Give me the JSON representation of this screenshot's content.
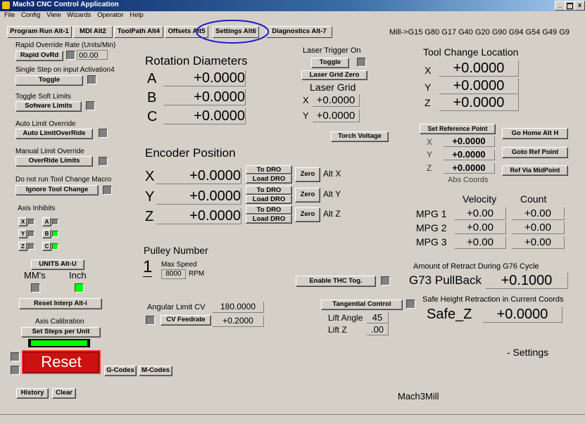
{
  "window": {
    "title": "Mach3 CNC Control Application",
    "min": "_",
    "max": " ",
    "close": "x"
  },
  "menu": [
    "File",
    "Config",
    "View",
    "Wizards",
    "Operator",
    "Help"
  ],
  "tabs": [
    "Program Run Alt-1",
    "MDI Alt2",
    "ToolPath Alt4",
    "Offsets Alt5",
    "Settings Alt6",
    "Diagnostics Alt-7"
  ],
  "gcode_status": "Mill->G15  G80 G17 G40 G20 G90 G94 G54 G49 G9",
  "left": {
    "rapid_override_title": "Rapid Override Rate (Units/Min)",
    "rapid_ovrd_btn": "Rapid OvRd",
    "rapid_value": "00.00",
    "single_step_title": "Single Step on input Activation4",
    "toggle_btn": "Toggle",
    "soft_limits_title": "Toggle Soft Limits",
    "soft_limits_btn": "Sofware Limits",
    "auto_limit_title": "Auto Limit Override",
    "auto_limit_btn": "Auto LimitOverRide",
    "manual_limit_title": "Manual Limit Override",
    "manual_limit_btn": "OverRide Limits",
    "tool_change_title": "Do not run Tool Change Macro",
    "tool_change_btn": "Ignore Tool Change",
    "axis_inhibits_title": "Axis Inhibits",
    "axis_x": "X",
    "axis_a": "A",
    "axis_y": "Y",
    "axis_b": "B",
    "axis_z": "Z",
    "axis_c": "C",
    "units_btn": "UNITS Alt-U",
    "mms_label": "MM's",
    "inch_label": "Inch",
    "reset_interp_btn": "Reset Interp Alt-i",
    "axis_calibration_title": "Axis Calibration",
    "set_steps_btn": "Set Steps per Unit",
    "reset_btn": "Reset",
    "gcodes_btn": "G-Codes",
    "mcodes_btn": "M-Codes",
    "history_btn": "History",
    "clear_btn": "Clear"
  },
  "rotation": {
    "title": "Rotation Diameters",
    "rows": [
      {
        "axis": "A",
        "value": "+0.0000"
      },
      {
        "axis": "B",
        "value": "+0.0000"
      },
      {
        "axis": "C",
        "value": "+0.0000"
      }
    ]
  },
  "encoder": {
    "title": "Encoder Position",
    "rows": [
      {
        "axis": "X",
        "value": "+0.0000",
        "to_dro": "To DRO",
        "load_dro": "Load DRO",
        "zero": "Zero",
        "alt": "Alt X"
      },
      {
        "axis": "Y",
        "value": "+0.0000",
        "to_dro": "To DRO",
        "load_dro": "Load DRO",
        "zero": "Zero",
        "alt": "Alt Y"
      },
      {
        "axis": "Z",
        "value": "+0.0000",
        "to_dro": "To DRO",
        "load_dro": "Load DRO",
        "zero": "Zero",
        "alt": "Alt Z"
      }
    ]
  },
  "pulley": {
    "title": "Pulley Number",
    "number": "1",
    "max_speed_label": "Max Speed",
    "max_speed": "8000",
    "rpm": "RPM"
  },
  "angular": {
    "label": "Angular Limit CV",
    "value": "180.0000",
    "cv_feedrate_btn": "CV Feedrate",
    "cv_value": "+0.2000"
  },
  "laser": {
    "trigger_title": "Laser Trigger On",
    "toggle_btn": "Toggle",
    "grid_zero_btn": "Laser Grid Zero",
    "grid_title": "Laser Grid",
    "x_label": "X",
    "x_value": "+0.0000",
    "y_label": "Y",
    "y_value": "+0.0000",
    "torch_btn": "Torch Voltage"
  },
  "thc": {
    "enable_btn": "Enable THC Tog."
  },
  "tangential": {
    "btn": "Tangential Control",
    "lift_angle_label": "Lift Angle",
    "lift_angle": "45",
    "lift_z_label": "Lift Z",
    "lift_z": ".00"
  },
  "tool_change": {
    "title": "Tool Change Location",
    "rows": [
      {
        "axis": "X",
        "value": "+0.0000"
      },
      {
        "axis": "Y",
        "value": "+0.0000"
      },
      {
        "axis": "Z",
        "value": "+0.0000"
      }
    ]
  },
  "reference": {
    "set_ref_btn": "Set Reference Point",
    "go_home_btn": "Go Home Alt H",
    "goto_ref_btn": "Goto Ref Point",
    "ref_mid_btn": "Ref Via MidPoint",
    "rows": [
      {
        "axis": "X",
        "value": "+0.0000"
      },
      {
        "axis": "Y",
        "value": "+0.0000"
      },
      {
        "axis": "Z",
        "value": "+0.0000"
      }
    ],
    "abs_coords": "Abs Coords"
  },
  "mpg": {
    "velocity_header": "Velocity",
    "count_header": "Count",
    "rows": [
      {
        "name": "MPG 1",
        "velocity": "+0.00",
        "count": "+0.00"
      },
      {
        "name": "MPG 2",
        "velocity": "+0.00",
        "count": "+0.00"
      },
      {
        "name": "MPG 3",
        "velocity": "+0.00",
        "count": "+0.00"
      }
    ]
  },
  "g76": {
    "title": "Amount of Retract During G76 Cycle",
    "label": "G73 PullBack",
    "value": "+0.1000"
  },
  "safe_z": {
    "title": "Safe Height Retraction in Current Coords",
    "label": "Safe_Z",
    "value": "+0.0000"
  },
  "screen_name": "- Settings",
  "profile": "Mach3Mill",
  "highlight_color": "#1a1acc",
  "reset_color": "#cc1111"
}
